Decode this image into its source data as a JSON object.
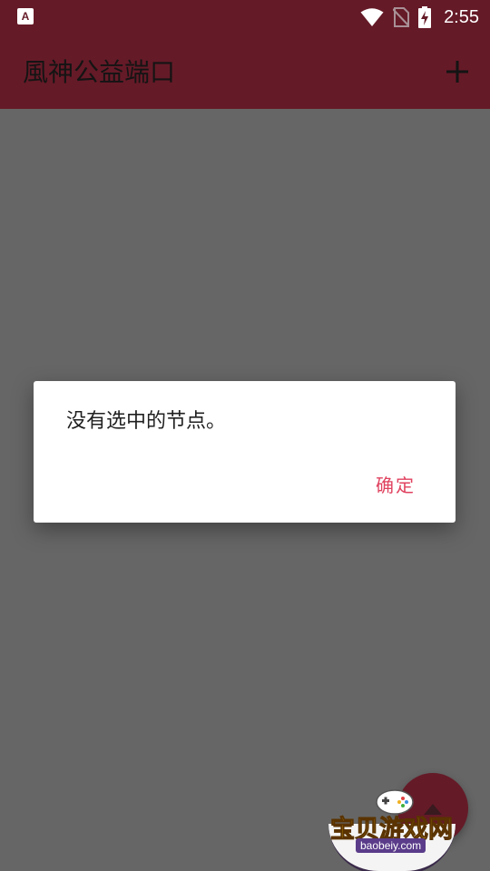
{
  "status_bar": {
    "app_icon_glyph": "A",
    "time": "2:55",
    "icons": [
      "wifi-icon",
      "no-sim-icon",
      "battery-charging-icon"
    ]
  },
  "toolbar": {
    "title": "風神公益端口",
    "add_icon": "plus-icon"
  },
  "dialog": {
    "message": "没有选中的节点。",
    "ok_label": "确定"
  },
  "fab": {
    "icon": "arrow-icon"
  },
  "watermark": {
    "brand": "宝贝游戏网",
    "url": "baobeiy.com"
  },
  "colors": {
    "primary": "#651a27",
    "accent": "#e0425f",
    "scrim": "#666666"
  }
}
